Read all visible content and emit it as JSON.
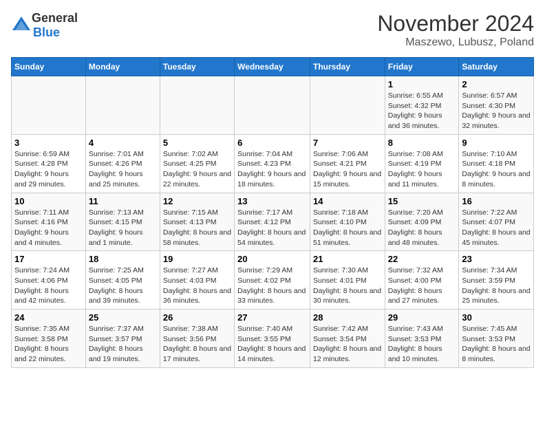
{
  "header": {
    "logo_general": "General",
    "logo_blue": "Blue",
    "month": "November 2024",
    "location": "Maszewo, Lubusz, Poland"
  },
  "weekdays": [
    "Sunday",
    "Monday",
    "Tuesday",
    "Wednesday",
    "Thursday",
    "Friday",
    "Saturday"
  ],
  "weeks": [
    [
      {
        "day": "",
        "info": ""
      },
      {
        "day": "",
        "info": ""
      },
      {
        "day": "",
        "info": ""
      },
      {
        "day": "",
        "info": ""
      },
      {
        "day": "",
        "info": ""
      },
      {
        "day": "1",
        "info": "Sunrise: 6:55 AM\nSunset: 4:32 PM\nDaylight: 9 hours and 36 minutes."
      },
      {
        "day": "2",
        "info": "Sunrise: 6:57 AM\nSunset: 4:30 PM\nDaylight: 9 hours and 32 minutes."
      }
    ],
    [
      {
        "day": "3",
        "info": "Sunrise: 6:59 AM\nSunset: 4:28 PM\nDaylight: 9 hours and 29 minutes."
      },
      {
        "day": "4",
        "info": "Sunrise: 7:01 AM\nSunset: 4:26 PM\nDaylight: 9 hours and 25 minutes."
      },
      {
        "day": "5",
        "info": "Sunrise: 7:02 AM\nSunset: 4:25 PM\nDaylight: 9 hours and 22 minutes."
      },
      {
        "day": "6",
        "info": "Sunrise: 7:04 AM\nSunset: 4:23 PM\nDaylight: 9 hours and 18 minutes."
      },
      {
        "day": "7",
        "info": "Sunrise: 7:06 AM\nSunset: 4:21 PM\nDaylight: 9 hours and 15 minutes."
      },
      {
        "day": "8",
        "info": "Sunrise: 7:08 AM\nSunset: 4:19 PM\nDaylight: 9 hours and 11 minutes."
      },
      {
        "day": "9",
        "info": "Sunrise: 7:10 AM\nSunset: 4:18 PM\nDaylight: 9 hours and 8 minutes."
      }
    ],
    [
      {
        "day": "10",
        "info": "Sunrise: 7:11 AM\nSunset: 4:16 PM\nDaylight: 9 hours and 4 minutes."
      },
      {
        "day": "11",
        "info": "Sunrise: 7:13 AM\nSunset: 4:15 PM\nDaylight: 9 hours and 1 minute."
      },
      {
        "day": "12",
        "info": "Sunrise: 7:15 AM\nSunset: 4:13 PM\nDaylight: 8 hours and 58 minutes."
      },
      {
        "day": "13",
        "info": "Sunrise: 7:17 AM\nSunset: 4:12 PM\nDaylight: 8 hours and 54 minutes."
      },
      {
        "day": "14",
        "info": "Sunrise: 7:18 AM\nSunset: 4:10 PM\nDaylight: 8 hours and 51 minutes."
      },
      {
        "day": "15",
        "info": "Sunrise: 7:20 AM\nSunset: 4:09 PM\nDaylight: 8 hours and 48 minutes."
      },
      {
        "day": "16",
        "info": "Sunrise: 7:22 AM\nSunset: 4:07 PM\nDaylight: 8 hours and 45 minutes."
      }
    ],
    [
      {
        "day": "17",
        "info": "Sunrise: 7:24 AM\nSunset: 4:06 PM\nDaylight: 8 hours and 42 minutes."
      },
      {
        "day": "18",
        "info": "Sunrise: 7:25 AM\nSunset: 4:05 PM\nDaylight: 8 hours and 39 minutes."
      },
      {
        "day": "19",
        "info": "Sunrise: 7:27 AM\nSunset: 4:03 PM\nDaylight: 8 hours and 36 minutes."
      },
      {
        "day": "20",
        "info": "Sunrise: 7:29 AM\nSunset: 4:02 PM\nDaylight: 8 hours and 33 minutes."
      },
      {
        "day": "21",
        "info": "Sunrise: 7:30 AM\nSunset: 4:01 PM\nDaylight: 8 hours and 30 minutes."
      },
      {
        "day": "22",
        "info": "Sunrise: 7:32 AM\nSunset: 4:00 PM\nDaylight: 8 hours and 27 minutes."
      },
      {
        "day": "23",
        "info": "Sunrise: 7:34 AM\nSunset: 3:59 PM\nDaylight: 8 hours and 25 minutes."
      }
    ],
    [
      {
        "day": "24",
        "info": "Sunrise: 7:35 AM\nSunset: 3:58 PM\nDaylight: 8 hours and 22 minutes."
      },
      {
        "day": "25",
        "info": "Sunrise: 7:37 AM\nSunset: 3:57 PM\nDaylight: 8 hours and 19 minutes."
      },
      {
        "day": "26",
        "info": "Sunrise: 7:38 AM\nSunset: 3:56 PM\nDaylight: 8 hours and 17 minutes."
      },
      {
        "day": "27",
        "info": "Sunrise: 7:40 AM\nSunset: 3:55 PM\nDaylight: 8 hours and 14 minutes."
      },
      {
        "day": "28",
        "info": "Sunrise: 7:42 AM\nSunset: 3:54 PM\nDaylight: 8 hours and 12 minutes."
      },
      {
        "day": "29",
        "info": "Sunrise: 7:43 AM\nSunset: 3:53 PM\nDaylight: 8 hours and 10 minutes."
      },
      {
        "day": "30",
        "info": "Sunrise: 7:45 AM\nSunset: 3:53 PM\nDaylight: 8 hours and 8 minutes."
      }
    ]
  ]
}
